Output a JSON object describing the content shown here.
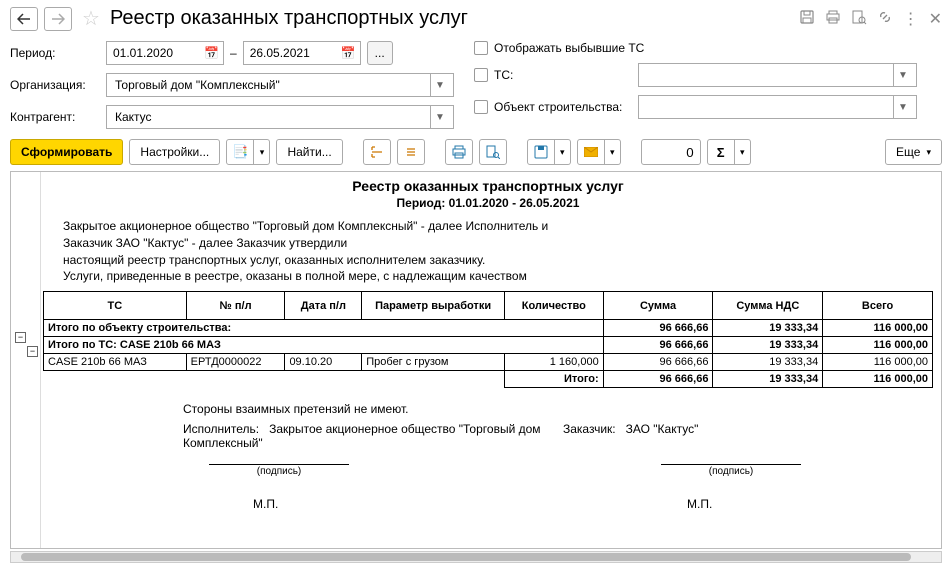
{
  "header": {
    "title": "Реестр оказанных транспортных услуг"
  },
  "filters": {
    "period_label": "Период:",
    "date_from": "01.01.2020",
    "date_separator": "–",
    "date_to": "26.05.2021",
    "org_label": "Организация:",
    "org_value": "Торговый дом \"Комплексный\"",
    "contr_label": "Контрагент:",
    "contr_value": "Кактус",
    "show_retired_label": "Отображать выбывшие ТС",
    "ts_label": "ТС:",
    "object_label": "Объект строительства:"
  },
  "toolbar": {
    "generate": "Сформировать",
    "settings": "Настройки...",
    "find": "Найти...",
    "more": "Еще",
    "sum_value": "0"
  },
  "report": {
    "title": "Реестр оказанных транспортных услуг",
    "subtitle": "Период: 01.01.2020 - 26.05.2021",
    "intro_line1": "Закрытое акционерное общество \"Торговый дом Комплексный\" - далее Исполнитель и",
    "intro_line2": "Заказчик ЗАО \"Кактус\" - далее Заказчик утвердили",
    "intro_line3": "настоящий реестр транспортных услуг, оказанных исполнителем заказчику.",
    "intro_line4": "Услуги, приведенные в реестре, оказаны в полной мере, с надлежащим качеством",
    "columns": {
      "c1": "ТС",
      "c2": "№ п/л",
      "c3": "Дата  п/л",
      "c4": "Параметр выработки",
      "c5": "Количество",
      "c6": "Сумма",
      "c7": "Сумма НДС",
      "c8": "Всего"
    },
    "subtotal_object_label": "Итого по объекту строительства:",
    "subtotal_ts_label": "Итого по ТС: CASE 210b 66 МАЗ",
    "subtotals": {
      "sum": "96 666,66",
      "nds": "19 333,34",
      "total": "116 000,00"
    },
    "row": {
      "ts": "CASE 210b 66 МАЗ",
      "num": "ЕРТД0000022",
      "date": "09.10.20",
      "param": "Пробег с грузом",
      "qty": "1 160,000",
      "sum": "96 666,66",
      "nds": "19 333,34",
      "total": "116 000,00"
    },
    "grand_label": "Итого:",
    "grand": {
      "sum": "96 666,66",
      "nds": "19 333,34",
      "total": "116 000,00"
    },
    "claims": "Стороны взаимных претензий  не имеют.",
    "executor_label": "Исполнитель:",
    "executor_value": "Закрытое акционерное общество \"Торговый дом Комплексный\"",
    "customer_label": "Заказчик:",
    "customer_value": "ЗАО \"Кактус\"",
    "sign_label": "(подпись)",
    "mp": "М.П."
  }
}
